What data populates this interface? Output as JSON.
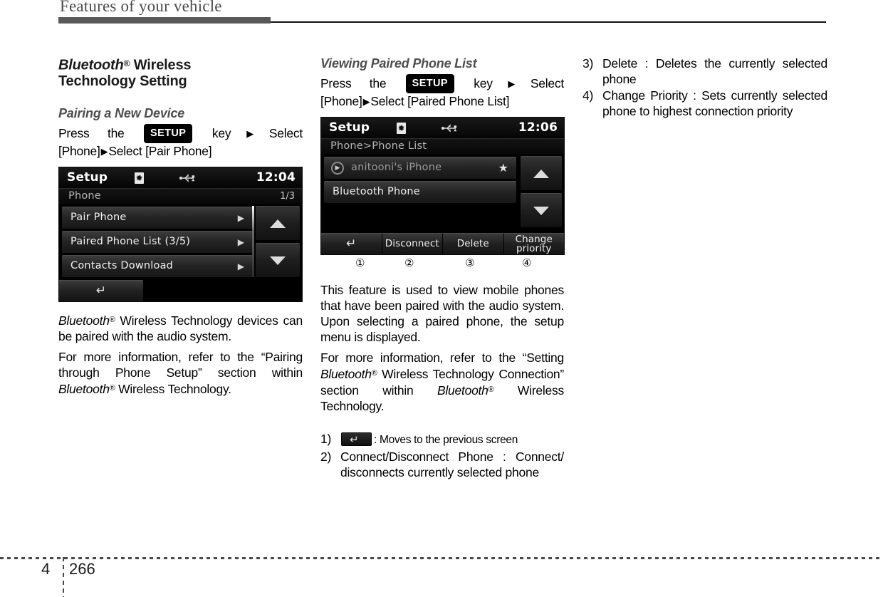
{
  "header": {
    "running_title": "Features of your vehicle"
  },
  "footer": {
    "chapter": "4",
    "page_number": "266"
  },
  "column1": {
    "section_title_parts": {
      "brand": "Bluetooth",
      "reg": "®",
      "rest": " Wireless",
      "line2": "Technology Setting"
    },
    "subsection_title": "Pairing a New Device",
    "instruction": {
      "before_key": "Press    the",
      "key_label": "SETUP",
      "after_key": "key",
      "step1": "Select [Phone]",
      "step2": "Select [Pair Phone]"
    },
    "screenshot": {
      "title": "Setup",
      "clock": "12:04",
      "bt_icon": "bluetooth-icon",
      "usb_icon": "usb-icon",
      "breadcrumb": "Phone",
      "page_indicator": "1/3",
      "rows": [
        {
          "label": "Pair Phone",
          "chevron": "▶"
        },
        {
          "label": "Paired Phone List (3/5)",
          "chevron": "▶"
        },
        {
          "label": "Contacts Download",
          "chevron": "▶"
        }
      ],
      "scroll_up": "▲",
      "scroll_down": "▼",
      "back_button": "back-arrow-icon"
    },
    "paragraphs": [
      {
        "pre": "",
        "brand": "Bluetooth",
        "reg": "®",
        "post": "  Wireless Technology devices can be paired with the audio system."
      },
      {
        "pre": "For more information, refer to the “Pairing through Phone Setup” section within ",
        "brand": "Bluetooth",
        "reg": "®",
        "post": "  Wireless Technology."
      }
    ]
  },
  "column2": {
    "subsection_title": "Viewing Paired Phone List",
    "instruction": {
      "before_key": "Press    the",
      "key_label": "SETUP",
      "after_key": "key",
      "step1": "Select [Phone]",
      "step2": "Select [Paired Phone List]"
    },
    "screenshot": {
      "title": "Setup",
      "clock": "12:06",
      "bt_icon": "bluetooth-icon",
      "usb_icon": "usb-icon",
      "breadcrumb": "Phone>Phone List",
      "rows": [
        {
          "label": "anitooni's iPhone",
          "selected": true,
          "star": "★",
          "play": "▶"
        },
        {
          "label": "Bluetooth Phone",
          "selected": false
        }
      ],
      "scroll_up": "▲",
      "scroll_down": "▼",
      "footer_buttons": [
        {
          "label": "",
          "icon": "back-arrow-icon"
        },
        {
          "label": "Disconnect"
        },
        {
          "label": "Delete"
        },
        {
          "label": "Change\npriority"
        }
      ]
    },
    "callouts": [
      "①",
      "②",
      "③",
      "④"
    ],
    "paragraphs": [
      {
        "text": "This feature is used to view mobile phones that have been paired with the audio system. Upon selecting a paired phone, the setup menu is displayed."
      },
      {
        "pre": "For more information, refer to the “Setting ",
        "brand": "Bluetooth",
        "reg": "®",
        "mid": "  Wireless Technology Connection” section within ",
        "brand2": "Bluetooth",
        "reg2": "®",
        "post": "  Wireless Technology."
      }
    ],
    "numbered_items": [
      {
        "num": "1)",
        "icon": "back-arrow-icon",
        "text": ": Moves to the previous screen"
      },
      {
        "num": "2)",
        "text": "Connect/Disconnect    Phone    :    Connect/ disconnects currently selected phone"
      }
    ]
  },
  "column3": {
    "numbered_items": [
      {
        "num": "3)",
        "text": "Delete : Deletes the currently selected phone"
      },
      {
        "num": "4)",
        "text": "Change Priority : Sets currently selected phone to highest connection priority"
      }
    ]
  }
}
